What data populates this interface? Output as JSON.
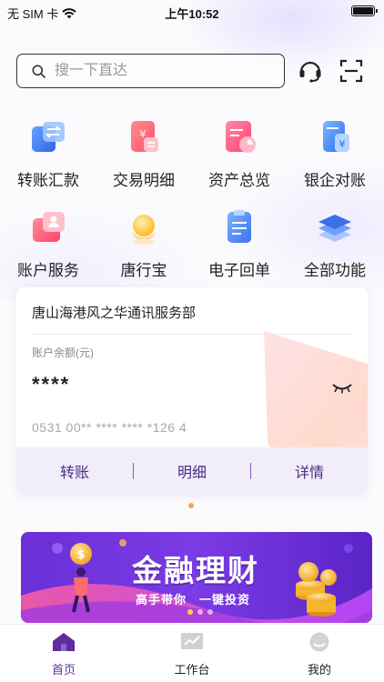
{
  "status_bar": {
    "carrier": "无 SIM 卡",
    "time": "上午10:52"
  },
  "search": {
    "placeholder": "搜一下直达"
  },
  "top_icons": [
    "headset-icon",
    "scan-icon"
  ],
  "grid": [
    {
      "label": "转账汇款",
      "icon": "transfer-icon"
    },
    {
      "label": "交易明细",
      "icon": "transaction-detail-icon"
    },
    {
      "label": "资产总览",
      "icon": "asset-overview-icon"
    },
    {
      "label": "银企对账",
      "icon": "reconciliation-icon"
    },
    {
      "label": "账户服务",
      "icon": "account-service-icon"
    },
    {
      "label": "唐行宝",
      "icon": "tanghangbao-icon"
    },
    {
      "label": "电子回单",
      "icon": "e-receipt-icon"
    },
    {
      "label": "全部功能",
      "icon": "all-functions-icon"
    }
  ],
  "account_card": {
    "company_name": "唐山海港风之华通讯服务部",
    "balance_label": "账户余额(元)",
    "balance": "****",
    "account_number": "0531 00** **** **** *126 4",
    "actions": [
      "转账",
      "明细",
      "详情"
    ]
  },
  "banner": {
    "title": "金融理财",
    "subtitle": "高手带你　一键投资"
  },
  "tabbar": [
    {
      "label": "首页",
      "icon": "home-icon",
      "active": true
    },
    {
      "label": "工作台",
      "icon": "workbench-icon",
      "active": false
    },
    {
      "label": "我的",
      "icon": "profile-icon",
      "active": false
    }
  ],
  "colors": {
    "accent_purple": "#5b2d9e",
    "card_action_text": "#4a2c8a",
    "pagination_dot": "#f5a54a"
  }
}
